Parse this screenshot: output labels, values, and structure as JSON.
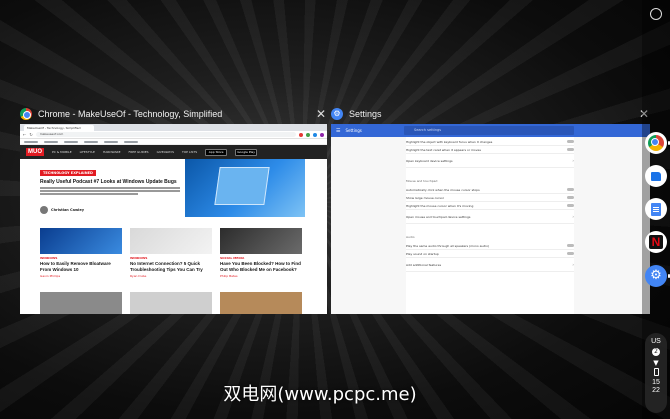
{
  "overview": {
    "windows": [
      {
        "title": "Chrome - MakeUseOf - Technology, Simplified"
      },
      {
        "title": "Settings"
      }
    ],
    "close_glyph": "✕"
  },
  "chrome": {
    "tab_label": "MakeUseOf - Technology, Simplified",
    "address": "makeuseof.com",
    "site": {
      "logo": "MUO",
      "nav": [
        "PC & MOBILE",
        "LIFESTYLE",
        "HARDWARE",
        "FREE GUIDES",
        "GIVEAWAYS",
        "TOP LISTS"
      ],
      "badges": [
        "App Store",
        "Google Play"
      ],
      "hero_tag": "TECHNOLOGY EXPLAINED",
      "hero_title": "Really Useful Podcast #7 Looks at Windows Update Bugs",
      "author": "Christian Cawley",
      "cards": [
        {
          "tag": "WINDOWS",
          "title": "How to Easily Remove Bloatware From Windows 10",
          "meta": "Gavin Phillips"
        },
        {
          "tag": "WINDOWS",
          "title": "No Internet Connection? 5 Quick Troubleshooting Tips You Can Try",
          "meta": "Ryan Dube"
        },
        {
          "tag": "SOCIAL MEDIA",
          "title": "Have You Been Blocked? How to Find Out Who Blocked Me on Facebook?",
          "meta": "Philip Bates"
        }
      ]
    }
  },
  "settings": {
    "header_label": "Settings",
    "search_placeholder": "Search settings",
    "sections": [
      {
        "heading": "",
        "rows": [
          "Highlight the object with keyboard focus when it changes",
          "Highlight the text caret when it appears or moves",
          "Open keyboard device settings"
        ]
      },
      {
        "heading": "Mouse and touchpad",
        "rows": [
          "Automatically click when the mouse cursor stops",
          "Show large mouse cursor",
          "Highlight the mouse cursor when it's moving",
          "Open mouse and touchpad device settings"
        ]
      },
      {
        "heading": "Audio",
        "rows": [
          "Play the same audio through all speakers (mono audio)",
          "Play sound on startup",
          "Add additional features"
        ]
      }
    ]
  },
  "shelf": {
    "apps": [
      {
        "name": "Chrome"
      },
      {
        "name": "Files"
      },
      {
        "name": "Docs"
      },
      {
        "name": "Netflix",
        "glyph": "N"
      },
      {
        "name": "Settings",
        "glyph": "⚙"
      }
    ],
    "status": {
      "lang": "US",
      "notif_count": "2",
      "time_h": "15",
      "time_m": "22"
    }
  },
  "watermark": "双电网(www.pcpc.me)"
}
